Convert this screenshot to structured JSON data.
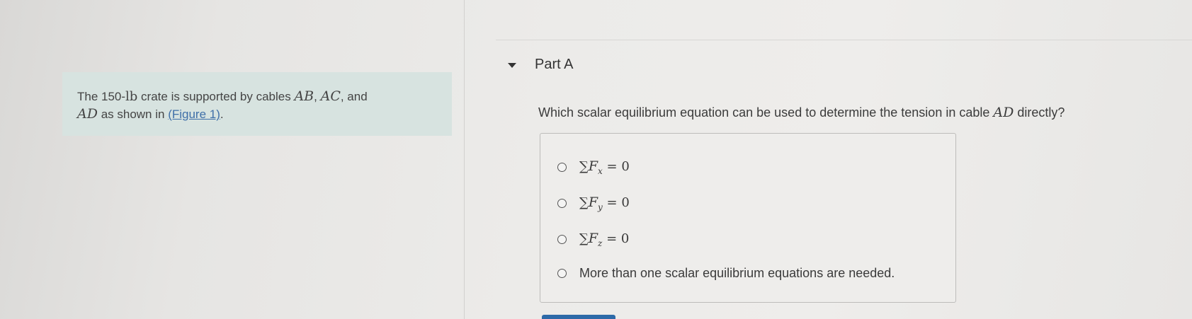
{
  "problem": {
    "text_1": "The 150-",
    "weight_unit": "lb",
    "text_2": " crate is supported by cables ",
    "cable_1": "AB",
    "sep_1": ", ",
    "cable_2": "AC",
    "text_3": ", and",
    "cable_3": "AD",
    "text_4": " as shown in ",
    "figure_link": "(Figure 1)",
    "text_5": "."
  },
  "part": {
    "title": "Part A",
    "toggle_icon": "caret-down-icon"
  },
  "question": {
    "text_before": "Which scalar equilibrium equation can be used to determine the tension in cable ",
    "cable": "AD",
    "text_after": " directly?"
  },
  "options": [
    {
      "sum": "∑",
      "var": "F",
      "sub": "x",
      "eq": " = 0"
    },
    {
      "sum": "∑",
      "var": "F",
      "sub": "y",
      "eq": " = 0"
    },
    {
      "sum": "∑",
      "var": "F",
      "sub": "z",
      "eq": " = 0"
    },
    {
      "text": "More than one scalar equilibrium equations are needed."
    }
  ]
}
